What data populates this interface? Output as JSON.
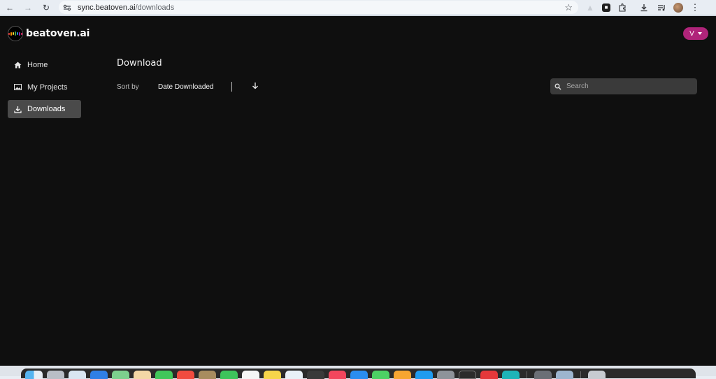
{
  "browser": {
    "url_host": "sync.beatoven.ai",
    "url_path": "/downloads"
  },
  "app": {
    "brand": "beatoven.ai",
    "user_initial": "V"
  },
  "sidebar": {
    "items": [
      {
        "label": "Home",
        "icon": "home-icon",
        "active": false
      },
      {
        "label": "My Projects",
        "icon": "image-icon",
        "active": false
      },
      {
        "label": "Downloads",
        "icon": "download-icon",
        "active": true
      }
    ]
  },
  "main": {
    "title": "Download",
    "sort_label": "Sort by",
    "sort_value": "Date Downloaded",
    "sort_direction_icon": "arrow-down-icon",
    "search_placeholder": "Search"
  },
  "colors": {
    "background": "#0f0f0f",
    "accent": "#b0247a",
    "active_item": "#4a4a4a",
    "search_bg": "#3a3a3a"
  },
  "dock": {
    "apps": [
      "finder",
      "launchpad",
      "safari",
      "mail",
      "maps",
      "photos",
      "messages",
      "calendar",
      "notes",
      "facetime",
      "notes-yellow",
      "reminders",
      "terminal",
      "music",
      "appstore",
      "facetime-green",
      "pages",
      "keynote",
      "settings",
      "activity",
      "photos-red",
      "preview",
      "chrome",
      "trash"
    ]
  }
}
